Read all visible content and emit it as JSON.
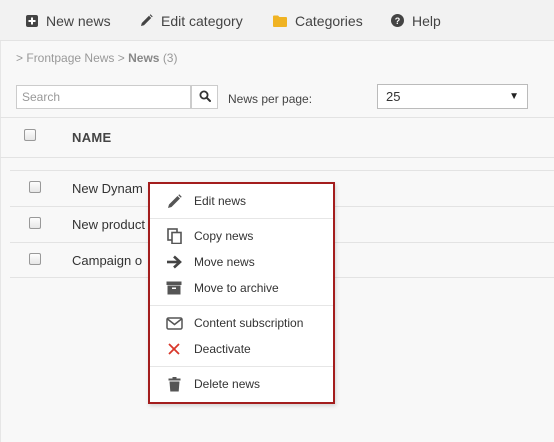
{
  "toolbar": {
    "new_news": "New news",
    "edit_category": "Edit category",
    "categories": "Categories",
    "help": "Help"
  },
  "breadcrumb": {
    "sep1": ">",
    "root": "Frontpage News",
    "sep2": ">",
    "current": "News",
    "count": "(3)"
  },
  "search": {
    "placeholder": "Search",
    "value": ""
  },
  "per_page": {
    "label": "News per page:",
    "value": "25"
  },
  "table": {
    "name_header": "NAME",
    "rows": [
      {
        "name": "New Dynam"
      },
      {
        "name": "New product"
      },
      {
        "name": "Campaign o"
      }
    ]
  },
  "context_menu": {
    "edit": "Edit news",
    "copy": "Copy news",
    "move": "Move news",
    "archive": "Move to archive",
    "subscription": "Content subscription",
    "deactivate": "Deactivate",
    "delete": "Delete news"
  },
  "colors": {
    "context_border": "#a31d1d",
    "folder_icon": "#f0b323",
    "deactivate_icon": "#d9372a"
  }
}
